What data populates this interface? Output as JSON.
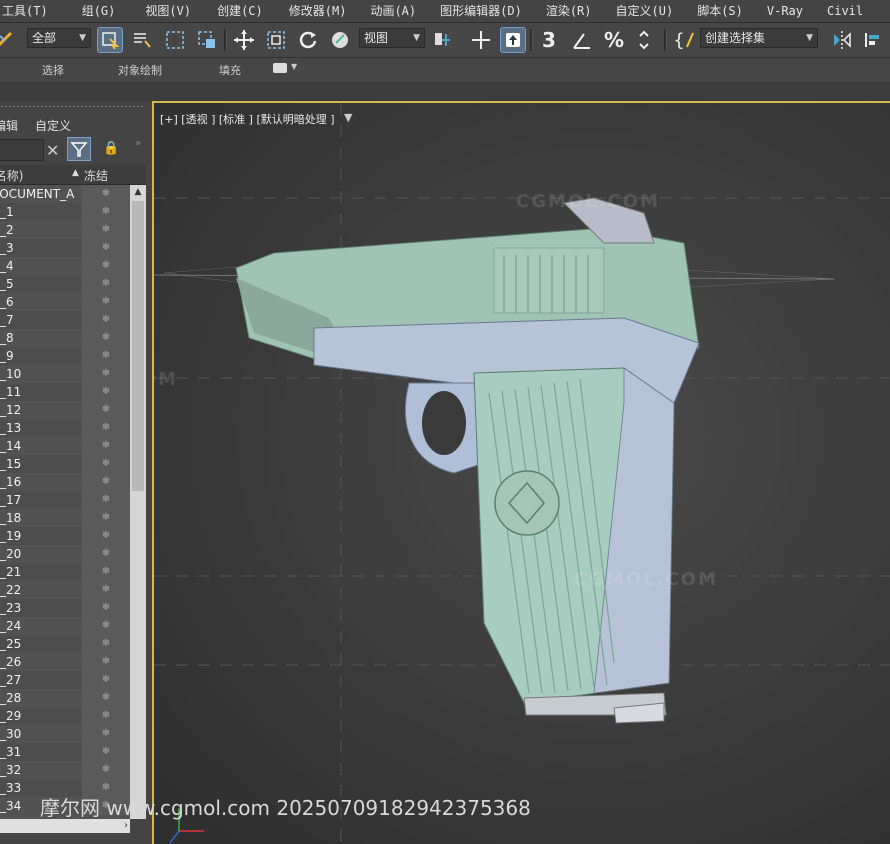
{
  "menu": [
    "工具(T)",
    "组(G)",
    "视图(V)",
    "创建(C)",
    "修改器(M)",
    "动画(A)",
    "图形编辑器(D)",
    "渲染(R)",
    "自定义(U)",
    "脚本(S)",
    "V-Ray",
    "Civil"
  ],
  "toolbar": {
    "selection_filter": "全部",
    "coord_system": "视图",
    "selection_set": "创建选择集"
  },
  "ribbon": {
    "tabs": [
      "选择",
      "对象绘制",
      "填充"
    ]
  },
  "explorer": {
    "tabs": [
      "编辑",
      "自定义"
    ],
    "col_name": "名称",
    "col_freeze": "冻结",
    "items": [
      "DOCUMENT_A",
      "_1",
      "_2",
      "_3",
      "_4",
      "_5",
      "_6",
      "_7",
      "_8",
      "_9",
      "_10",
      "_11",
      "_12",
      "_13",
      "_14",
      "_15",
      "_16",
      "_17",
      "_18",
      "_19",
      "_20",
      "_21",
      "_22",
      "_23",
      "_24",
      "_25",
      "_26",
      "_27",
      "_28",
      "_29",
      "_30",
      "_31",
      "_32",
      "_33",
      "_34"
    ]
  },
  "viewport": {
    "label": "[+] [透视 ] [标准 ] [默认明暗处理 ]"
  },
  "watermark": {
    "site": "www.cgmol.com",
    "footer": "摩尔网 www.cgmol.com 20250709182942375368",
    "logo_text": "CGMOL.COM"
  }
}
